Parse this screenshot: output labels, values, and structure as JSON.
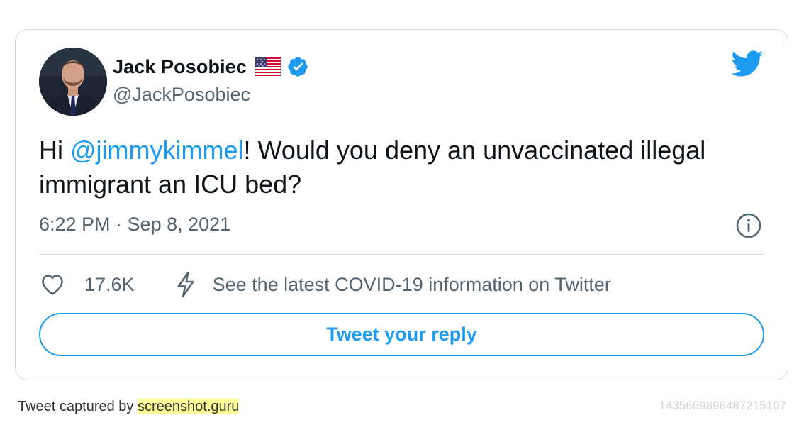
{
  "tweet": {
    "author_name": "Jack Posobiec",
    "author_handle": "@JackPosobiec",
    "text_prefix": "Hi ",
    "mention": "@jimmykimmel",
    "text_suffix": "! Would you deny an unvaccinated illegal immigrant an ICU bed?",
    "timestamp": "6:22 PM · Sep 8, 2021",
    "like_count": "17.6K",
    "covid_notice": "See the latest COVID-19 information on Twitter",
    "reply_label": "Tweet your reply"
  },
  "footer": {
    "captured_by": "Tweet captured by ",
    "captured_link": "screenshot.guru",
    "tweet_id": "1435669896487215107"
  },
  "icons": {
    "logo": "twitter-bird-icon",
    "verified": "verified-badge-icon",
    "flag": "us-flag-icon",
    "info": "info-icon",
    "like": "heart-icon",
    "covid": "lightning-icon"
  },
  "colors": {
    "accent": "#1d9bf0",
    "text": "#0f1419",
    "secondary_text": "#536471",
    "border": "#cfd9de",
    "footer_highlight": "#ffff99"
  }
}
